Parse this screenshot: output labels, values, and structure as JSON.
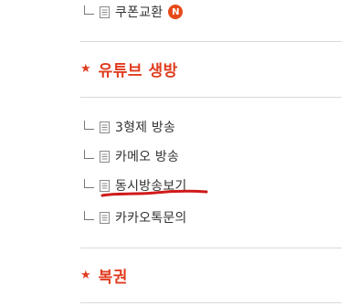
{
  "menu": {
    "top_items": [
      {
        "label": "쿠폰교환",
        "badge": "N"
      }
    ],
    "sections": [
      {
        "title": "유튜브 생방",
        "items": [
          {
            "label": "3형제 방송"
          },
          {
            "label": "카메오 방송"
          },
          {
            "label": "동시방송보기"
          },
          {
            "label": "카카오톡문의"
          }
        ]
      },
      {
        "title": "복권",
        "items": []
      }
    ]
  },
  "colors": {
    "accent": "#e03c1f",
    "badge": "#e64a19",
    "annotation": "#d01a1a",
    "divider": "#d9d9d9"
  },
  "icons": {
    "section": "star-icon",
    "item": "document-icon",
    "tree": "tree-branch-icon"
  }
}
